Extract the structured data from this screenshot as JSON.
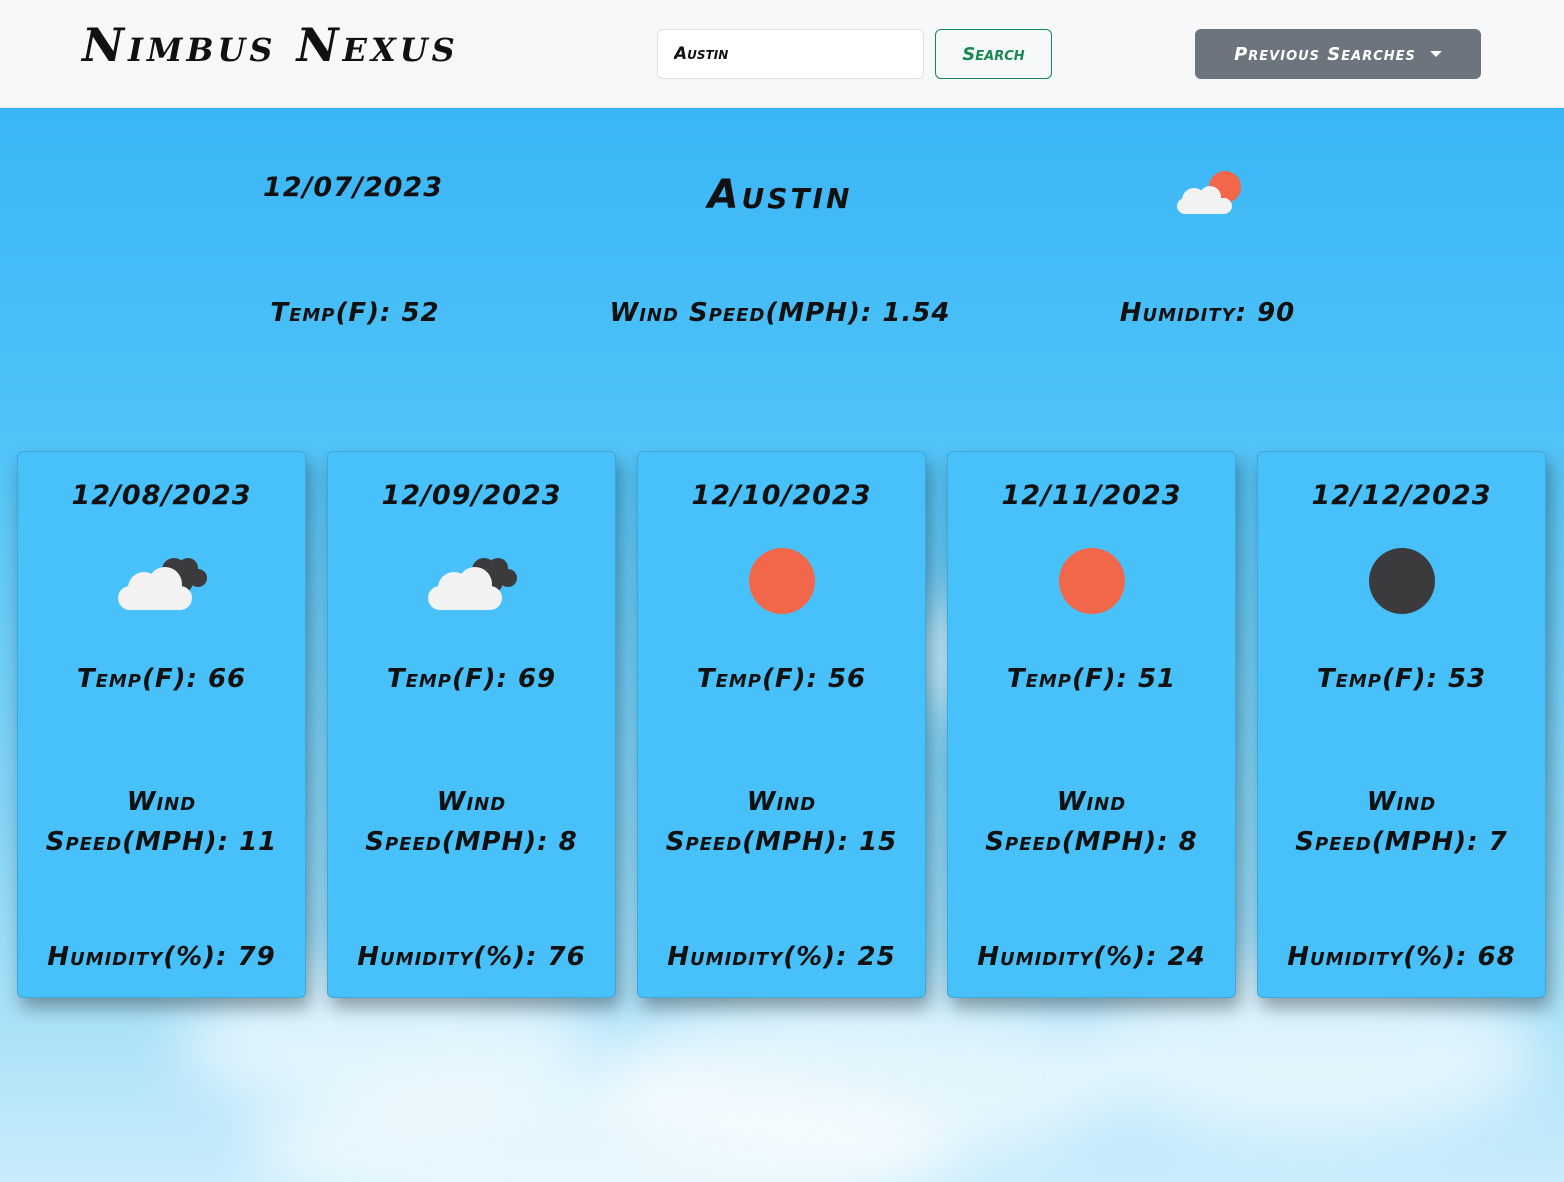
{
  "app": {
    "title": "Nimbus Nexus"
  },
  "search": {
    "value": "Austin",
    "button_label": "Search"
  },
  "history": {
    "button_label": "Previous Searches"
  },
  "current": {
    "date": "12/07/2023",
    "city": "Austin",
    "icon": "partly-cloudy-day-icon",
    "temp": "Temp(F): 52",
    "wind": "Wind Speed(MPH): 1.54",
    "humidity": "Humidity: 90"
  },
  "forecast": [
    {
      "date": "12/08/2023",
      "icon": "cloudy-icon",
      "temp": "Temp(F): 66",
      "wind_line1": "Wind",
      "wind_line2": "Speed(MPH): 11",
      "humidity": "Humidity(%): 79"
    },
    {
      "date": "12/09/2023",
      "icon": "cloudy-icon",
      "temp": "Temp(F): 69",
      "wind_line1": "Wind",
      "wind_line2": "Speed(MPH): 8",
      "humidity": "Humidity(%): 76"
    },
    {
      "date": "12/10/2023",
      "icon": "clear-day-icon",
      "temp": "Temp(F): 56",
      "wind_line1": "Wind",
      "wind_line2": "Speed(MPH): 15",
      "humidity": "Humidity(%): 25"
    },
    {
      "date": "12/11/2023",
      "icon": "clear-day-icon",
      "temp": "Temp(F): 51",
      "wind_line1": "Wind",
      "wind_line2": "Speed(MPH): 8",
      "humidity": "Humidity(%): 24"
    },
    {
      "date": "12/12/2023",
      "icon": "clear-night-icon",
      "temp": "Temp(F): 53",
      "wind_line1": "Wind",
      "wind_line2": "Speed(MPH): 7",
      "humidity": "Humidity(%): 68"
    }
  ],
  "colors": {
    "sky_top": "#33b1f6",
    "card_bg": "#48c0fa",
    "search_green": "#198754",
    "history_gray": "#6c757d",
    "sun": "#f26649",
    "moon": "#3b3b3d"
  }
}
